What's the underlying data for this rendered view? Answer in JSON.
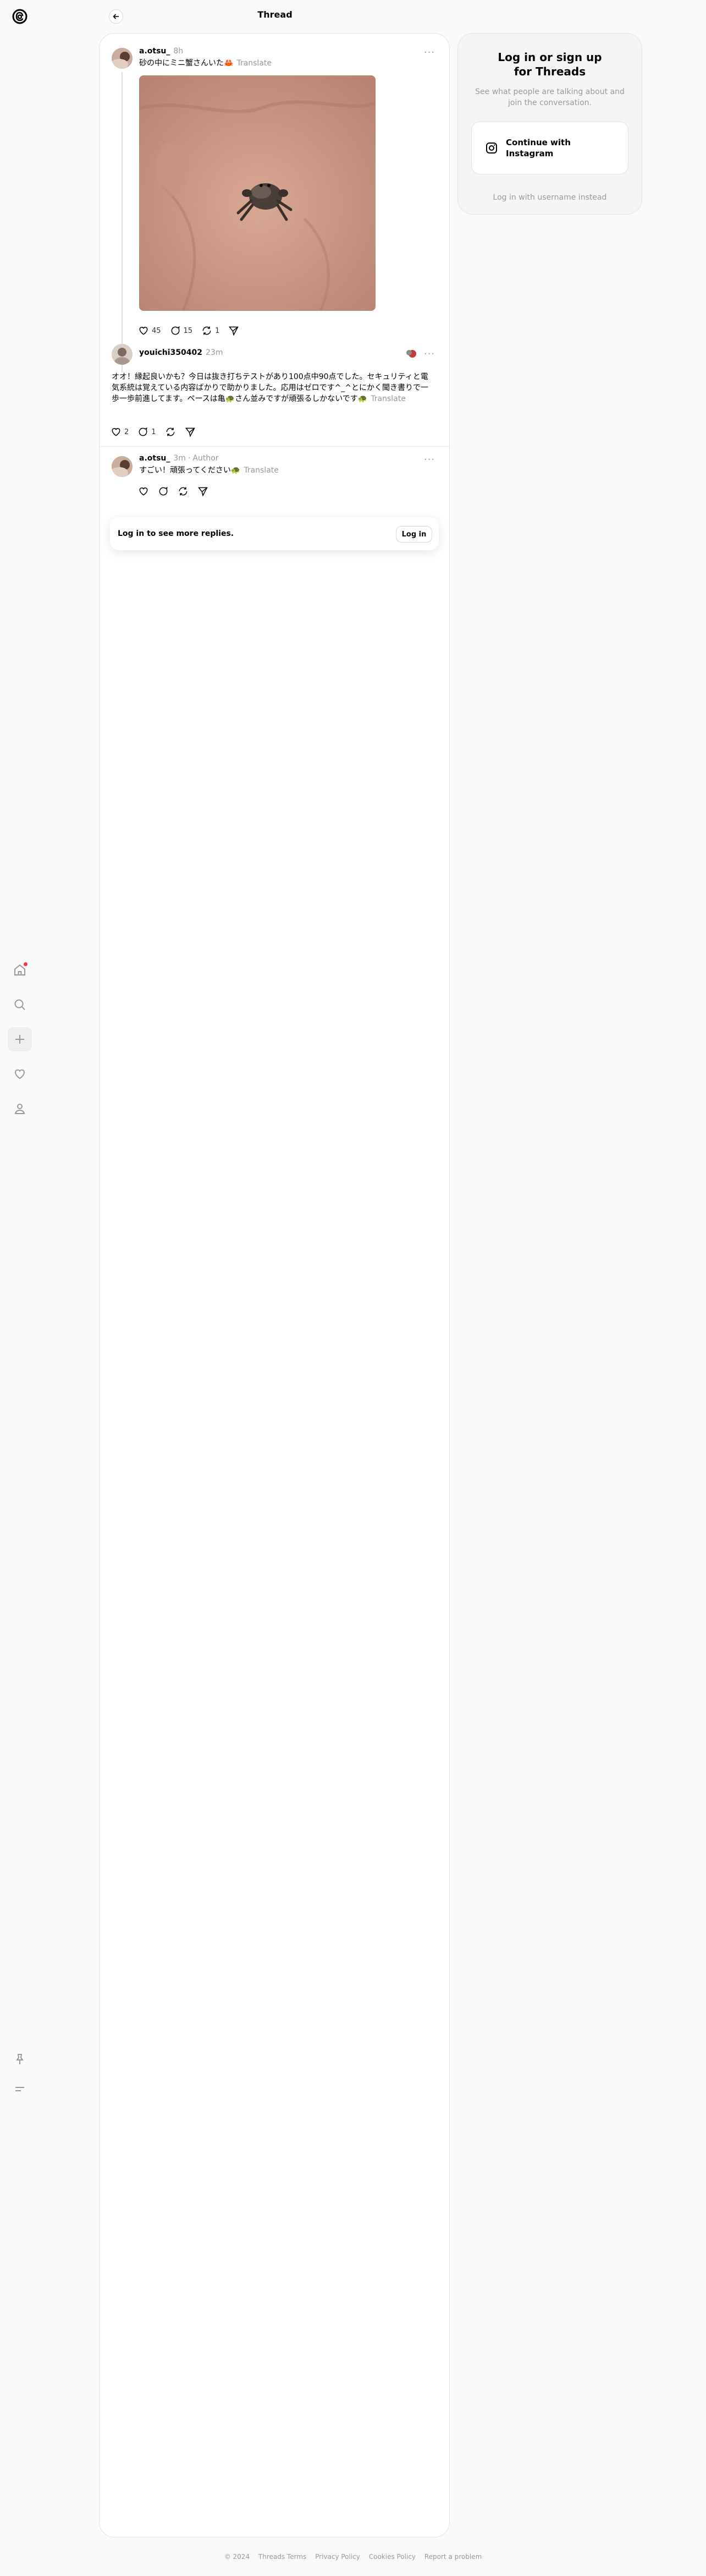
{
  "header": {
    "title": "Thread"
  },
  "posts": [
    {
      "username": "a.otsu_",
      "time": "8h",
      "text": "砂の中にミニ蟹さんいた🦀",
      "translate": "Translate",
      "likes": "45",
      "replies": "15",
      "reposts": "1"
    },
    {
      "username": "youichi350402",
      "time": "23m",
      "text": "オオ！縁起良いかも？今日は抜き打ちテストがあり100点中90点でした。セキュリティと電気系統は覚えている内容ばかりで助かりました。応用はゼロです^_^とにかく聞き書りで一歩一歩前進してます。ペースは亀🐢さん並みですが頑張るしかないです🐢",
      "translate": "Translate",
      "likes": "2",
      "replies": "1"
    },
    {
      "username": "a.otsu_",
      "time": "3m",
      "author": "Author",
      "text": "すごい！頑張ってください🐢",
      "translate": "Translate"
    }
  ],
  "login_prompt": {
    "text": "Log in to see more replies.",
    "button": "Log in"
  },
  "sidebar_card": {
    "title": "Log in or sign up for Threads",
    "subtitle": "See what people are talking about and join the conversation.",
    "instagram_button": "Continue with Instagram",
    "alt_login": "Log in with username instead"
  },
  "footer": {
    "links": [
      "© 2024",
      "Threads Terms",
      "Privacy Policy",
      "Cookies Policy",
      "Report a problem"
    ]
  },
  "colors": {
    "notification": "#ff3040",
    "muted": "#999999"
  }
}
